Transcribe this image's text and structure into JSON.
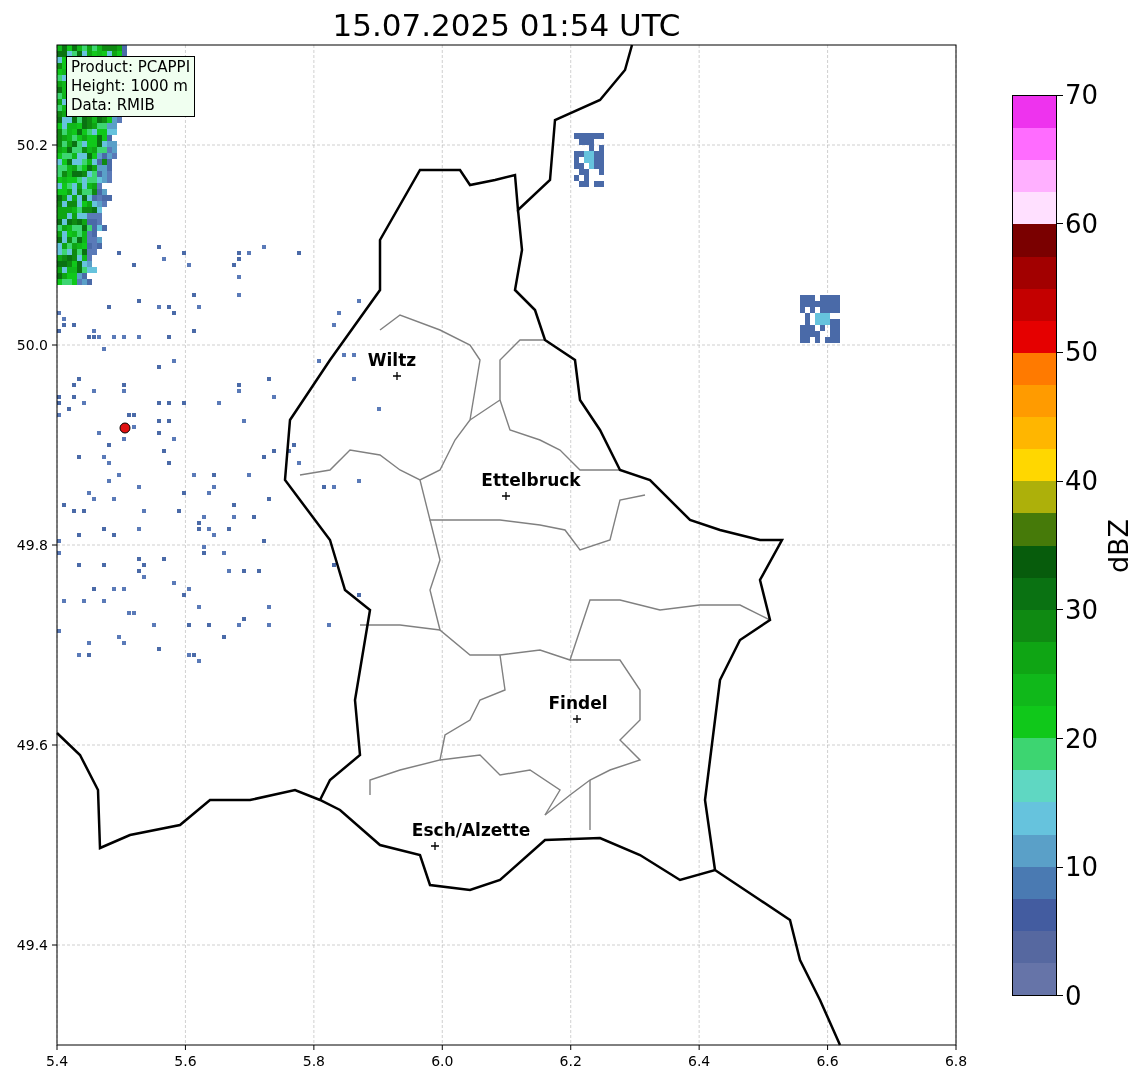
{
  "title": "15.07.2025 01:54 UTC",
  "info_box": [
    "Product: PCAPPI",
    "Height: 1000 m",
    "Data: RMIB"
  ],
  "map": {
    "xticks": [
      "5.4",
      "5.6",
      "5.8",
      "6.0",
      "6.2",
      "6.4",
      "6.6",
      "6.8"
    ],
    "yticks": [
      "50.2",
      "50.0",
      "49.8",
      "49.6",
      "49.4"
    ],
    "cities": [
      {
        "name": "Wiltz"
      },
      {
        "name": "Ettelbruck"
      },
      {
        "name": "Findel"
      },
      {
        "name": "Esch/Alzette"
      }
    ]
  },
  "colorbar": {
    "label": "dBZ",
    "ticks": [
      "70",
      "60",
      "50",
      "40",
      "30",
      "20",
      "10",
      "0"
    ],
    "segments": [
      {
        "color": "#ee33ee"
      },
      {
        "color": "#ff6cff"
      },
      {
        "color": "#ffb0ff"
      },
      {
        "color": "#ffe0ff"
      },
      {
        "color": "#7a0000"
      },
      {
        "color": "#a20000"
      },
      {
        "color": "#c40000"
      },
      {
        "color": "#e50000"
      },
      {
        "color": "#ff7a00"
      },
      {
        "color": "#ff9b00"
      },
      {
        "color": "#ffb600"
      },
      {
        "color": "#ffd700"
      },
      {
        "color": "#adb00a"
      },
      {
        "color": "#467a09"
      },
      {
        "color": "#075c0c"
      },
      {
        "color": "#0a7212"
      },
      {
        "color": "#0f8a12"
      },
      {
        "color": "#0fa514"
      },
      {
        "color": "#10b81a"
      },
      {
        "color": "#10c81a"
      },
      {
        "color": "#3dd571"
      },
      {
        "color": "#5fd7c2"
      },
      {
        "color": "#66c3dd"
      },
      {
        "color": "#5aa0c8"
      },
      {
        "color": "#4a7ab2"
      },
      {
        "color": "#435ca0"
      },
      {
        "color": "#5668a0"
      },
      {
        "color": "#6674a8"
      }
    ]
  }
}
